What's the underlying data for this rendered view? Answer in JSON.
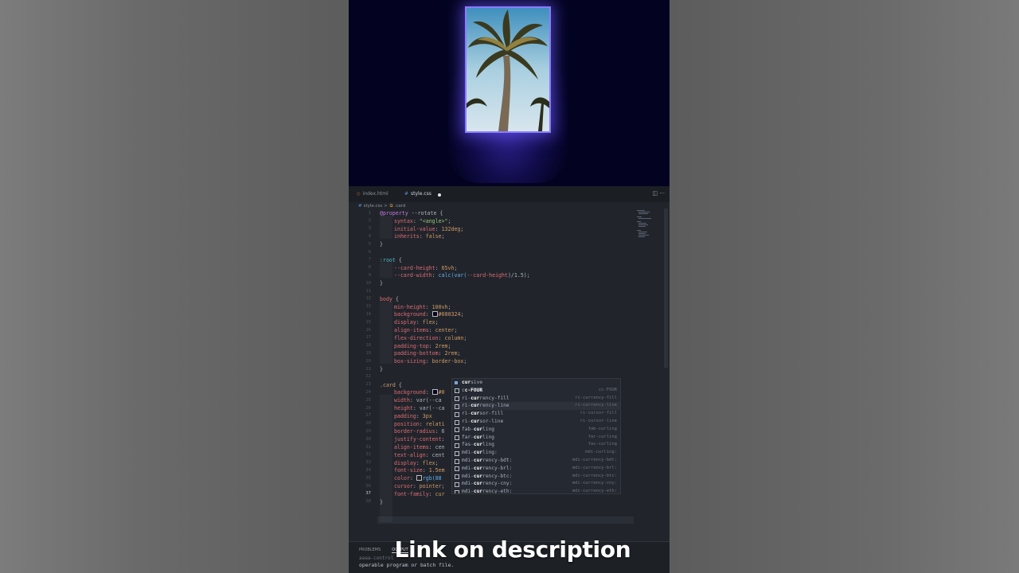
{
  "preview": {
    "background": "#030321",
    "card_border": "#8a7cff"
  },
  "tabs": [
    {
      "label": "index.html",
      "icon": "html5-icon"
    },
    {
      "label": "style.css",
      "icon": "css-hash-icon",
      "unsaved": true
    }
  ],
  "breadcrumb": {
    "file": "style.css",
    "separator": ">",
    "symbol": ".card"
  },
  "line_numbers": [
    "1",
    "2",
    "3",
    "4",
    "5",
    "6",
    "7",
    "8",
    "9",
    "10",
    "11",
    "12",
    "13",
    "14",
    "15",
    "16",
    "17",
    "18",
    "19",
    "20",
    "21",
    "22",
    "23",
    "24",
    "25",
    "26",
    "27",
    "28",
    "29",
    "30",
    "31",
    "32",
    "33",
    "34",
    "35",
    "36",
    "37",
    "38"
  ],
  "current_line": "37",
  "code": {
    "l1a": "@property",
    "l1b": " --rotate {",
    "l2a": "syntax",
    "l2b": ": ",
    "l2c": "\"<angle>\"",
    "l2d": ";",
    "l3a": "initial-value",
    "l3b": ": ",
    "l3c": "132deg",
    "l3d": ";",
    "l4a": "inherits",
    "l4b": ": ",
    "l4c": "false",
    "l4d": ";",
    "l5": "}",
    "l7a": ":root",
    "l7b": " {",
    "l8a": "--card-height",
    "l8b": ": ",
    "l8c": "65vh",
    "l8d": ";",
    "l9a": "--card-width",
    "l9b": ": ",
    "l9c": "calc(",
    "l9d": "var(",
    "l9e": "--card-height",
    "l9f": ")/1.5);",
    "l10": "}",
    "l12a": "body",
    "l12b": " {",
    "l13a": "min-height",
    "l13b": ": ",
    "l13c": "100vh",
    "l13d": ";",
    "l14a": "background",
    "l14b": ": ",
    "l14c": "#080324",
    "l14d": ";",
    "l15a": "display",
    "l15b": ": ",
    "l15c": "flex",
    "l15d": ";",
    "l16a": "align-items",
    "l16b": ": ",
    "l16c": "center",
    "l16d": ";",
    "l17a": "flex-direction",
    "l17b": ": ",
    "l17c": "column",
    "l17d": ";",
    "l18a": "padding-top",
    "l18b": ": ",
    "l18c": "2rem",
    "l18d": ";",
    "l19a": "padding-bottom",
    "l19b": ": ",
    "l19c": "2rem",
    "l19d": ";",
    "l20a": "box-sizing",
    "l20b": ": ",
    "l20c": "border-box",
    "l20d": ";",
    "l21": "}",
    "l23a": ".card",
    "l23b": " {",
    "l24a": "background",
    "l24b": ": ",
    "l24c": "#0",
    "l25a": "width",
    "l25b": ": var(--ca",
    "l26a": "height",
    "l26b": ": var(--ca",
    "l27a": "padding",
    "l27b": ": ",
    "l27c": "3px",
    "l28a": "position",
    "l28b": ": ",
    "l28c": "relati",
    "l29a": "border-radius",
    "l29b": ": 6",
    "l30a": "justify-content",
    "l30b": ":",
    "l31a": "align-items",
    "l31b": ": cen",
    "l32a": "text-align",
    "l32b": ": cent",
    "l33a": "display",
    "l33b": ": ",
    "l33c": "flex",
    "l33d": ";",
    "l34a": "font-size",
    "l34b": ": ",
    "l34c": "1.5em",
    "l35a": "color",
    "l35b": ": ",
    "l35c": "rgb(88",
    "l36a": "cursor",
    "l36b": ": ",
    "l36c": "pointer",
    "l36d": ";",
    "l37a": "font-family",
    "l37b": ": ",
    "l37c": "cur",
    "l38": "}"
  },
  "autocomplete": [
    {
      "pre": "",
      "match": "cur",
      "post": "sive",
      "detail": "",
      "icon": "property-icon"
    },
    {
      "pre": "c",
      "match": "c-FOUR",
      "post": "",
      "detail": "cc-FOUR",
      "icon": "square-icon"
    },
    {
      "pre": "ri-",
      "match": "cur",
      "post": "rency-fill",
      "detail": "ri-currency-fill",
      "icon": "square-icon"
    },
    {
      "pre": "ri-",
      "match": "cur",
      "post": "rency-line",
      "detail": "ri-currency-line",
      "icon": "square-icon"
    },
    {
      "pre": "ri-",
      "match": "cur",
      "post": "sor-fill",
      "detail": "ri-cursor-fill",
      "icon": "square-icon"
    },
    {
      "pre": "ri-",
      "match": "cur",
      "post": "sor-line",
      "detail": "ri-cursor-line",
      "icon": "square-icon"
    },
    {
      "pre": "fab-",
      "match": "cur",
      "post": "ling",
      "detail": "fab-curling",
      "icon": "square-icon"
    },
    {
      "pre": "far-",
      "match": "cur",
      "post": "ling",
      "detail": "far-curling",
      "icon": "square-icon"
    },
    {
      "pre": "fas-",
      "match": "cur",
      "post": "ling",
      "detail": "fas-curling",
      "icon": "square-icon"
    },
    {
      "pre": "mdi-",
      "match": "cur",
      "post": "ling:",
      "detail": "mdi-curling:",
      "icon": "square-icon"
    },
    {
      "pre": "mdi-",
      "match": "cur",
      "post": "rency-bdt:",
      "detail": "mdi-currency-bdt:",
      "icon": "square-icon"
    },
    {
      "pre": "mdi-",
      "match": "cur",
      "post": "rency-brl:",
      "detail": "mdi-currency-brl:",
      "icon": "square-icon"
    },
    {
      "pre": "mdi-",
      "match": "cur",
      "post": "rency-btc:",
      "detail": "mdi-currency-btc:",
      "icon": "square-icon"
    },
    {
      "pre": "mdi-",
      "match": "cur",
      "post": "rency-cny:",
      "detail": "mdi-currency-cny:",
      "icon": "square-icon"
    },
    {
      "pre": "mdi-",
      "match": "cur",
      "post": "rency-eth:",
      "detail": "mdi-currency-eth:",
      "icon": "square-icon"
    }
  ],
  "panel": {
    "tabs": [
      "PROBLEMS",
      "OUTPUT"
    ],
    "line1": "aaaa-control",
    "line2": "operable program or batch file."
  },
  "caption": "Link on description"
}
